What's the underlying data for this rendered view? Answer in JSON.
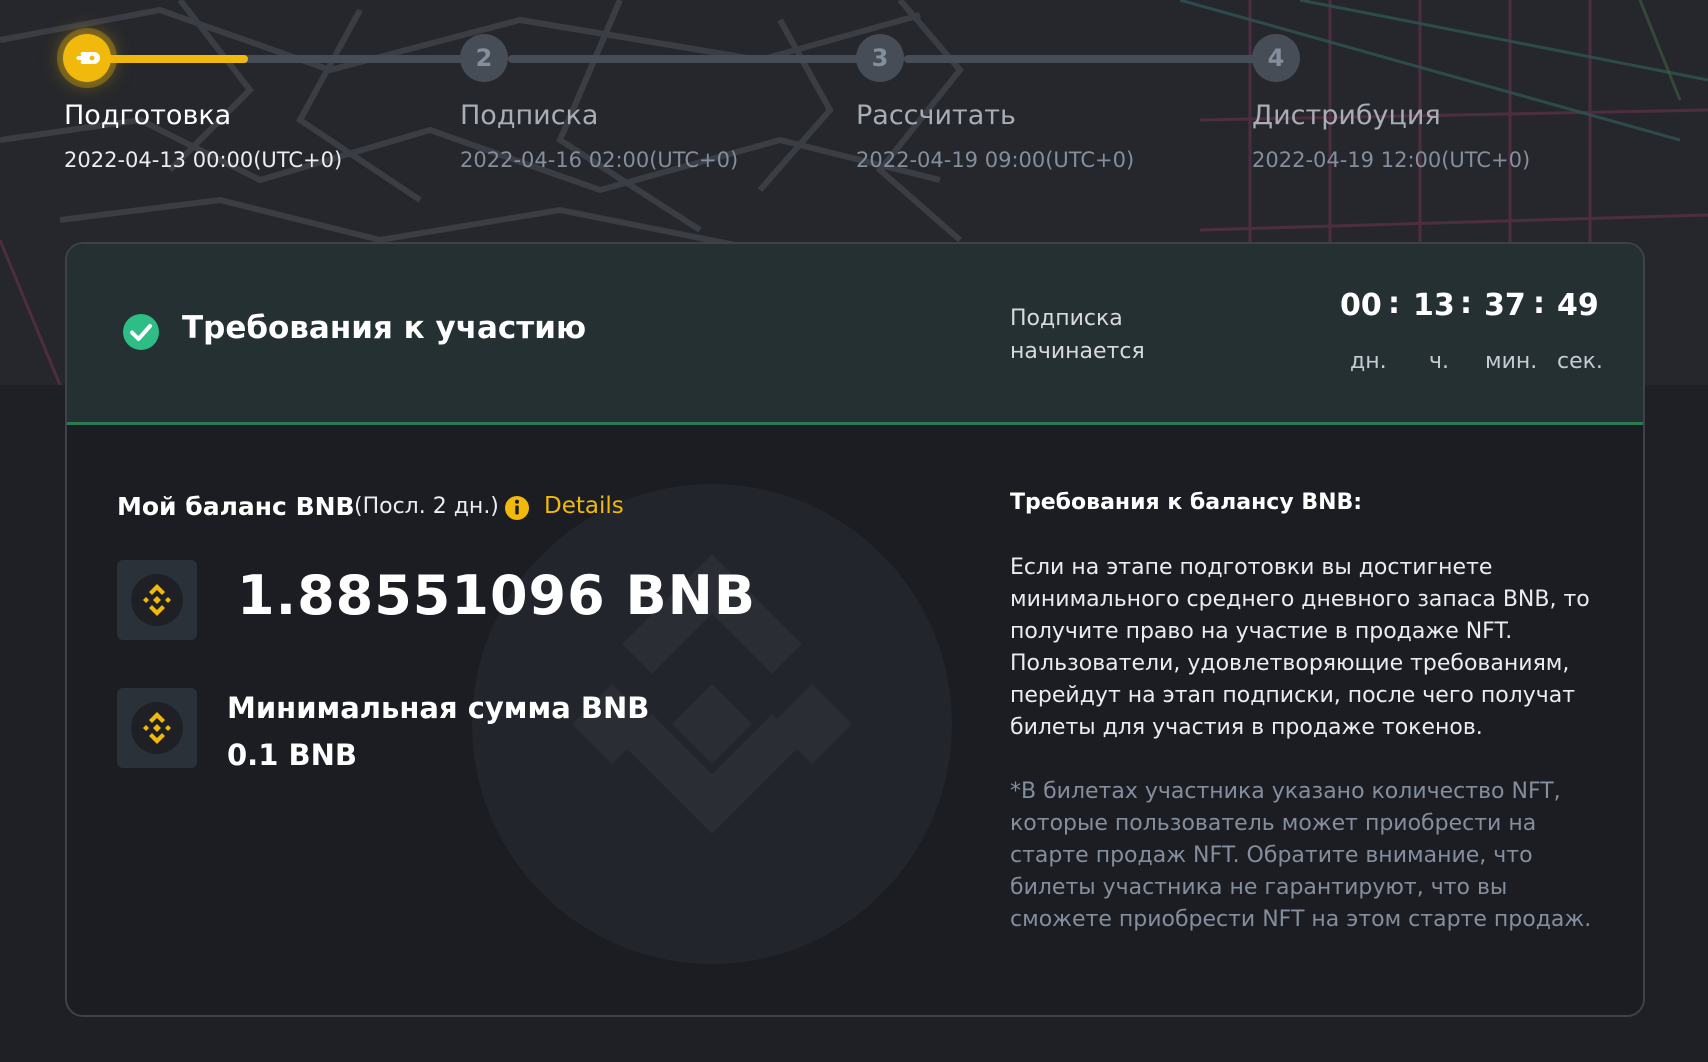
{
  "stepper": {
    "steps": [
      {
        "label": "Подготовка",
        "date": "2022-04-13 00:00(UTC+0)",
        "number": "",
        "status": "current"
      },
      {
        "label": "Подписка",
        "date": "2022-04-16 02:00(UTC+0)",
        "number": "2",
        "status": "pending"
      },
      {
        "label": "Рассчитать",
        "date": "2022-04-19 09:00(UTC+0)",
        "number": "3",
        "status": "pending"
      },
      {
        "label": "Дистрибуция",
        "date": "2022-04-19 12:00(UTC+0)",
        "number": "4",
        "status": "pending"
      }
    ],
    "progress_in_first_segment": 0.38
  },
  "requirements": {
    "title": "Требования к участию",
    "subscription_starts_label": "Подписка начинается",
    "countdown": {
      "days": "00",
      "hours": "13",
      "minutes": "37",
      "seconds": "49",
      "separator": ":",
      "days_unit": "дн.",
      "hours_unit": "ч.",
      "minutes_unit": "мин.",
      "seconds_unit": "сек."
    }
  },
  "balance": {
    "title": "Мой баланс BNB",
    "period": "(Посл. 2 дн.)",
    "details_label": "Details",
    "amount": "1.88551096 BNB",
    "min_label": "Минимальная сумма BNB",
    "min_value": "0.1 BNB"
  },
  "bnb_requirements": {
    "title": "Требования к балансу BNB:",
    "description": "Если на этапе подготовки вы достигнете минимального среднего дневного запаса BNB, то получите право на участие в продаже NFT. Пользователи, удовлетворяющие требованиям, перейдут на этап подписки, после чего получат билеты для участия в продаже токенов.",
    "note": "*В билетах участника указано количество NFT, которые пользователь может приобрести на старте продаж NFT. Обратите внимание, что билеты участника не гарантируют, что вы сможете приобрести NFT на этом старте продаж."
  },
  "colors": {
    "accent": "#f0b90b",
    "success": "#2ebd85",
    "background": "#1e2026",
    "header_bg": "#253033"
  },
  "icons": {
    "step_current": "rocket-icon",
    "requirements": "check-circle-icon",
    "info": "info-icon",
    "coin": "bnb-coin-icon"
  }
}
